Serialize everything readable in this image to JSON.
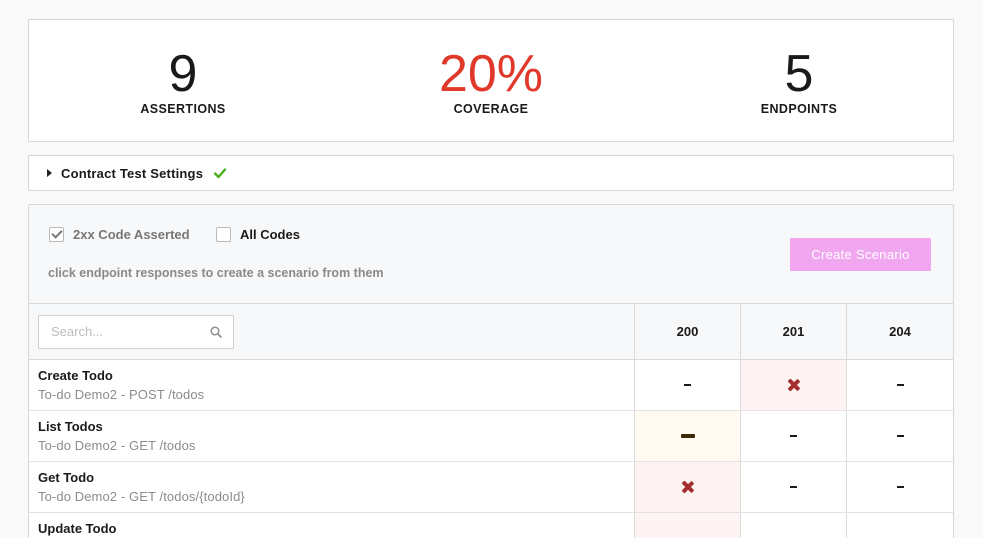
{
  "stats": {
    "assertions": {
      "value": "9",
      "label": "ASSERTIONS"
    },
    "coverage": {
      "value": "20%",
      "label": "COVERAGE",
      "color": "#e0392b"
    },
    "endpoints": {
      "value": "5",
      "label": "ENDPOINTS"
    }
  },
  "settings": {
    "title": "Contract Test Settings",
    "status_icon": "green-check-icon",
    "expanded": false
  },
  "options": {
    "two_xx": {
      "label": "2xx Code Asserted",
      "checked": true
    },
    "all_codes": {
      "label": "All Codes",
      "checked": false
    },
    "hint": "click endpoint responses to create a scenario from them",
    "create_button": "Create Scenario",
    "create_button_color": "#f0a7f0"
  },
  "table": {
    "search_placeholder": "Search...",
    "columns": [
      "200",
      "201",
      "204"
    ],
    "rows": [
      {
        "name": "Create Todo",
        "sub": "To-do Demo2 - POST /todos",
        "cells": [
          "none",
          "fail",
          "none"
        ]
      },
      {
        "name": "List Todos",
        "sub": "To-do Demo2 - GET /todos",
        "cells": [
          "partial",
          "none",
          "none"
        ]
      },
      {
        "name": "Get Todo",
        "sub": "To-do Demo2 - GET /todos/{todoId}",
        "cells": [
          "fail",
          "none",
          "none"
        ]
      },
      {
        "name": "Update Todo",
        "sub": "",
        "cells": [
          "fail",
          "none",
          "none"
        ]
      }
    ]
  }
}
